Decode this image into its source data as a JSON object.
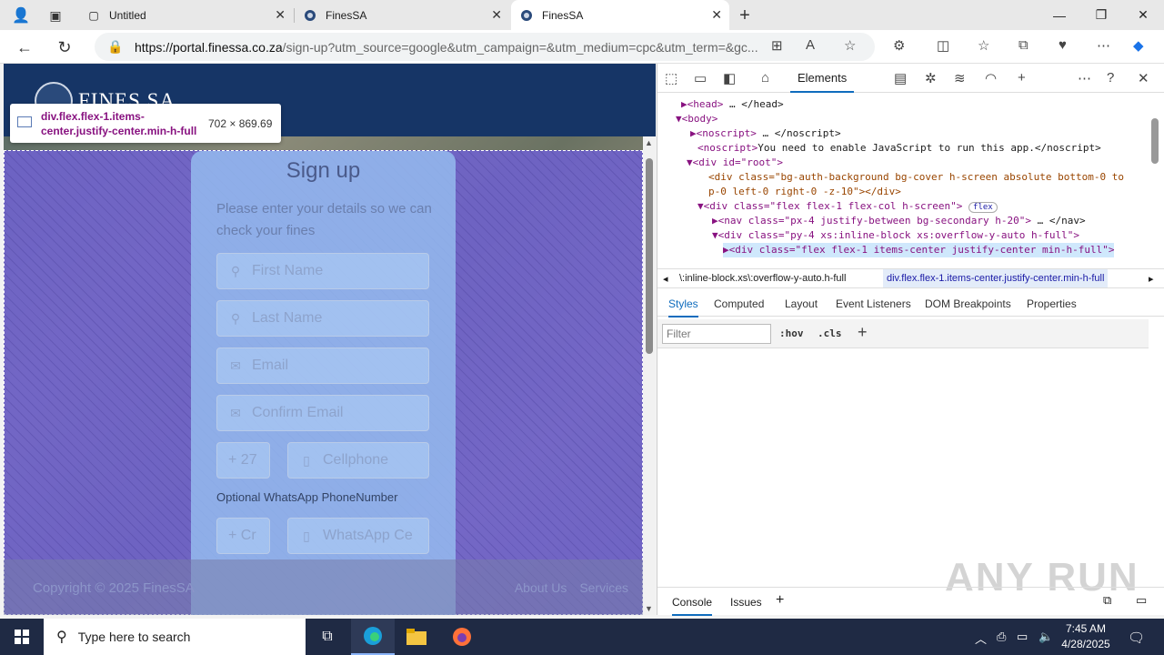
{
  "browser": {
    "tabs": [
      {
        "title": "Untitled",
        "active": false
      },
      {
        "title": "FinesSA",
        "active": false
      },
      {
        "title": "FinesSA",
        "active": true
      }
    ],
    "url_host": "https://portal.finessa.co.za",
    "url_rest": "/sign-up?utm_source=google&utm_campaign=&utm_medium=cpc&utm_term=&gc..."
  },
  "site": {
    "logo_text": "FINES SA",
    "tooltip": {
      "selector": "div.flex.flex-1.items-center.justify-center.min-h-full",
      "size": "702 × 869.69"
    },
    "form": {
      "title": "Sign up",
      "description": "Please enter your details so we can check your fines",
      "first_name_placeholder": "First Name",
      "last_name_placeholder": "Last Name",
      "email_placeholder": "Email",
      "confirm_email_placeholder": "Confirm Email",
      "country_code": "+ 27",
      "cellphone_placeholder": "Cellphone",
      "whatsapp_label": "Optional WhatsApp PhoneNumber",
      "whatsapp_code_placeholder": "+ Cr",
      "whatsapp_placeholder": "WhatsApp Ce"
    },
    "footer": {
      "copyright": "Copyright © 2025 FinesSA",
      "links": [
        "About Us",
        "Services"
      ]
    }
  },
  "devtools": {
    "active_tab": "Elements",
    "dom_lines": [
      {
        "indent": 0,
        "text_tag": "▶<head>",
        "text_rest": "… </head>"
      },
      {
        "indent": 0,
        "text_tag": "▼<body>",
        "text_rest": ""
      },
      {
        "indent": 1,
        "text_tag": "▶<noscript>",
        "text_rest": "… </noscript>"
      },
      {
        "indent": 1,
        "text_tag": "<noscript>",
        "text_rest": "You need to enable JavaScript to run this app.</noscript>"
      },
      {
        "indent": 1,
        "text_tag": "▼<div id=\"root\">",
        "text_rest": ""
      },
      {
        "indent": 2,
        "text_tag": "<div class=\"bg-auth-background bg-cover h-screen absolute bottom-0 to",
        "text_rest": ""
      },
      {
        "indent": 2,
        "text_tag": "p-0 left-0 right-0 -z-10\"></div>",
        "text_rest": ""
      },
      {
        "indent": 2,
        "text_tag": "▼<div class=\"flex flex-1 flex-col h-screen\">",
        "text_rest": "flex"
      },
      {
        "indent": 3,
        "text_tag": "▶<nav class=\"px-4 justify-between bg-secondary h-20\">",
        "text_rest": "… </nav>"
      },
      {
        "indent": 3,
        "text_tag": "▼<div class=\"py-4 xs:inline-block xs:overflow-y-auto h-full\">",
        "text_rest": ""
      },
      {
        "indent": 4,
        "text_tag": "▶<div class=\"flex flex-1 items-center justify-center min-h-full\">",
        "text_rest": ""
      }
    ],
    "breadcrumb_left": "\\:inline-block.xs\\:overflow-y-auto.h-full",
    "breadcrumb_selected": "div.flex.flex-1.items-center.justify-center.min-h-full",
    "subtabs": [
      "Styles",
      "Computed",
      "Layout",
      "Event Listeners",
      "DOM Breakpoints",
      "Properties"
    ],
    "filter_placeholder": "Filter",
    "hov": ":hov",
    "cls": ".cls",
    "drawer_tabs": [
      "Console",
      "Issues"
    ],
    "watermark": "ANY RUN"
  },
  "taskbar": {
    "search_placeholder": "Type here to search",
    "time": "7:45 AM",
    "date": "4/28/2025"
  }
}
